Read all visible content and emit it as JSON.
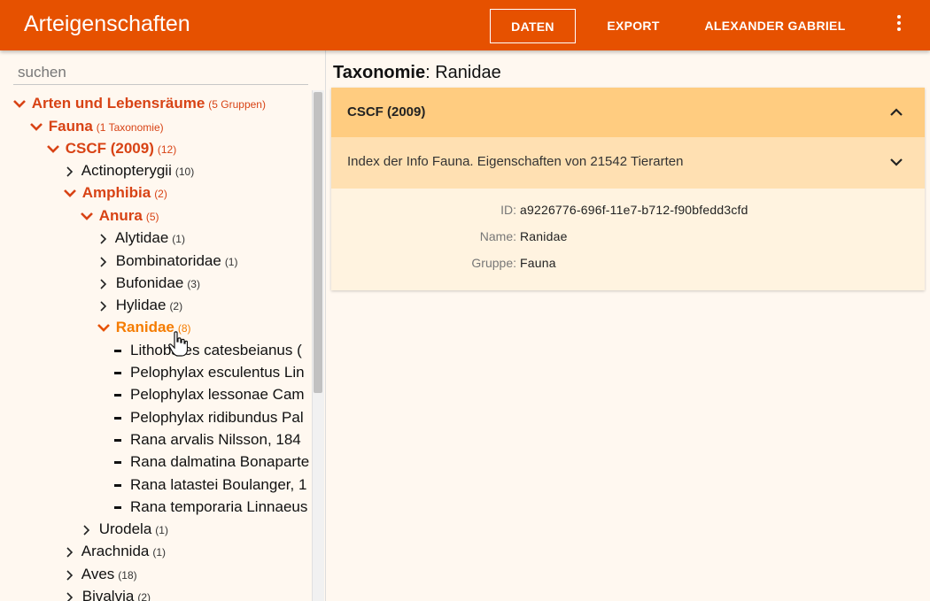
{
  "app": {
    "title": "Arteigenschaften"
  },
  "nav": {
    "daten": "DATEN",
    "export": "EXPORT",
    "user": "ALEXANDER GABRIEL",
    "more_icon": "more-vert-icon"
  },
  "search": {
    "placeholder": "suchen",
    "value": ""
  },
  "tree": [
    {
      "label": "Arten und Lebensräume",
      "count": "(5 Gruppen)",
      "state": "open"
    },
    {
      "label": "Fauna",
      "count": "(1 Taxonomie)",
      "state": "open"
    },
    {
      "label": "CSCF (2009)",
      "count": "(12)",
      "state": "open"
    },
    {
      "label": "Actinopterygii",
      "count": "(10)",
      "state": "closed"
    },
    {
      "label": "Amphibia",
      "count": "(2)",
      "state": "open"
    },
    {
      "label": "Anura",
      "count": "(5)",
      "state": "open"
    },
    {
      "label": "Alytidae",
      "count": "(1)",
      "state": "closed"
    },
    {
      "label": "Bombinatoridae",
      "count": "(1)",
      "state": "closed"
    },
    {
      "label": "Bufonidae",
      "count": "(3)",
      "state": "closed"
    },
    {
      "label": "Hylidae",
      "count": "(2)",
      "state": "closed"
    },
    {
      "label": "Ranidae",
      "count": "(8)",
      "state": "active"
    },
    {
      "label": "Lithobates catesbeianus (",
      "count": "",
      "state": "leaf"
    },
    {
      "label": "Pelophylax esculentus Lin",
      "count": "",
      "state": "leaf"
    },
    {
      "label": "Pelophylax lessonae Cam",
      "count": "",
      "state": "leaf"
    },
    {
      "label": "Pelophylax ridibundus Pal",
      "count": "",
      "state": "leaf"
    },
    {
      "label": "Rana arvalis Nilsson, 184",
      "count": "",
      "state": "leaf"
    },
    {
      "label": "Rana dalmatina Bonaparte",
      "count": "",
      "state": "leaf"
    },
    {
      "label": "Rana latastei Boulanger, 1",
      "count": "",
      "state": "leaf"
    },
    {
      "label": "Rana temporaria Linnaeus",
      "count": "",
      "state": "leaf"
    },
    {
      "label": "Urodela",
      "count": "(1)",
      "state": "closed"
    },
    {
      "label": "Arachnida",
      "count": "(1)",
      "state": "closed"
    },
    {
      "label": "Aves",
      "count": "(18)",
      "state": "closed"
    },
    {
      "label": "Bivalvia",
      "count": "(2)",
      "state": "closed"
    }
  ],
  "detail": {
    "title_key": "Taxonomie",
    "title_value": ": Ranidae",
    "panel_label": "CSCF (2009)",
    "sub_label": "Index der Info Fauna. Eigenschaften von 21542 Tierarten",
    "props": [
      {
        "key": "ID:",
        "value": "a9226776-696f-11e7-b712-f90bfedd3cfd"
      },
      {
        "key": "Name:",
        "value": "Ranidae"
      },
      {
        "key": "Gruppe:",
        "value": "Fauna"
      }
    ]
  },
  "colors": {
    "appbar": "#e65100",
    "open": "#d84315",
    "active": "#f57c00",
    "panel_head": "#ffcc80",
    "panel_sub": "#ffe0b2",
    "panel_body": "#fff3e0"
  }
}
